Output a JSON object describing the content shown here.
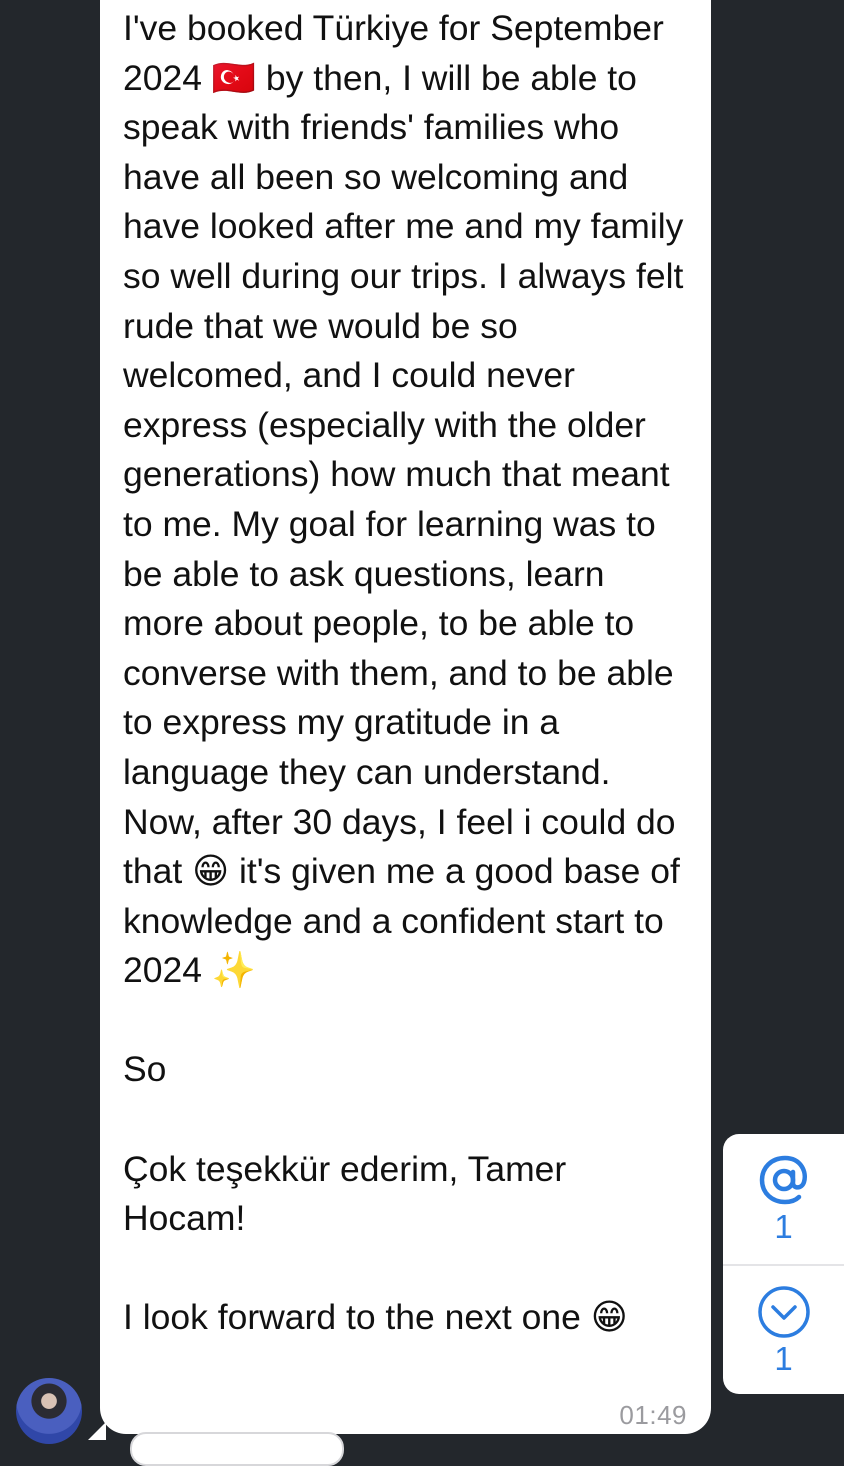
{
  "message": {
    "text": "I've booked Türkiye for September 2024 🇹🇷 by then, I will be able to speak with friends' families who have all been so welcoming and have looked after me and my family so well during our trips. I always felt rude that we would be so welcomed, and I could never express (especially with the older generations) how much that meant to me. My goal for learning was to be able to ask questions, learn more about people, to be able to converse with them, and to be able to express my gratitude in a language they can understand. Now, after 30 days, I feel i could do that 😁 it's given me a good base of knowledge and a confident start to 2024 ✨\n\nSo\n\nÇok teşekkür ederim, Tamer Hocam!\n\nI look forward to the next one 😁",
    "time": "01:49"
  },
  "nav": {
    "mentions_count": "1",
    "unread_count": "1",
    "mention_icon": "at-icon",
    "down_icon": "chevron-down-icon"
  },
  "colors": {
    "background": "#23272c",
    "bubble": "#ffffff",
    "accent": "#2c7de0",
    "time": "#9b9b9f"
  }
}
